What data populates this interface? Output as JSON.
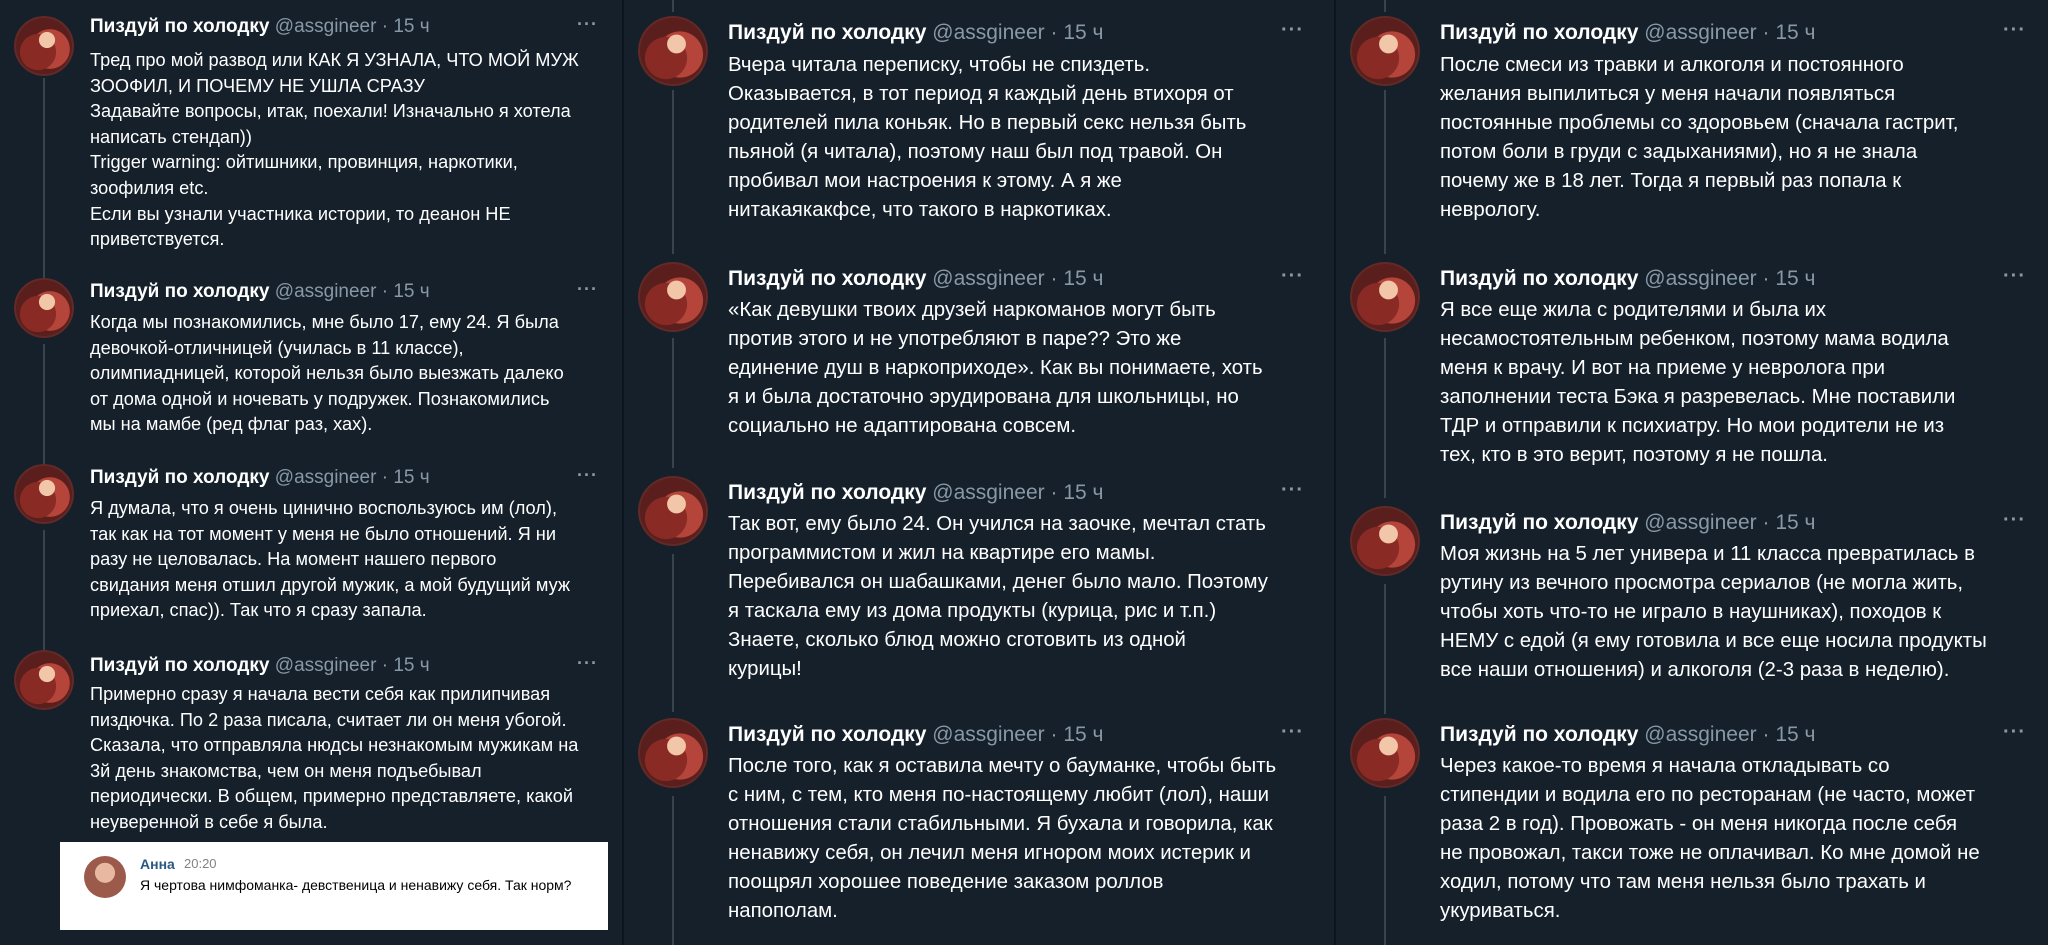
{
  "author": {
    "display_name": "Пиздуй по холодку",
    "handle": "@assgineer",
    "separator": "·",
    "time": "15 ч",
    "avatar_icon": "profile-photo"
  },
  "more_label": "···",
  "columns": [
    {
      "tweets": [
        {
          "text": "Тред про мой развод или КАК Я УЗНАЛА, ЧТО МОЙ МУЖ\nЗООФИЛ, И ПОЧЕМУ НЕ УШЛА СРАЗУ\nЗадавайте вопросы, итак, поехали! Изначально я хотела\nнаписать стендап))\nTrigger warning: ойтишники, провинция, наркотики,\nзоофилия etc.\nЕсли вы узнали участника истории, то деанон НЕ\nприветствуется."
        },
        {
          "text": "Когда мы познакомились, мне было 17, ему 24. Я была\nдевочкой-отличницей (училась в 11 классе),\nолимпиадницей, которой нельзя было выезжать далеко\nот дома одной и ночевать у подружек. Познакомились\nмы на мамбе (ред флаг раз, хах)."
        },
        {
          "text": "Я думала, что я очень цинично воспользуюсь им (лол),\nтак как на тот момент у меня не было отношений. Я ни\nразу не целовалась. На момент нашего первого\nсвидания меня отшил другой мужик, а мой будущий муж\nприехал, спас)). Так что я сразу запала."
        },
        {
          "text": "Примерно сразу я начала вести себя как прилипчивая\nпиздючка. По 2 раза писала, считает ли он меня убогой.\nСказала, что отправляла нюдсы незнакомым мужикам на\n3й день знакомства, чем он меня подъебывал\nпериодически. В общем, примерно представляете, какой\nнеуверенной в себе я была."
        }
      ],
      "quote_card": {
        "name": "Анна",
        "time": "20:20",
        "text": "Я чертова нимфоманка- девственица и ненавижу себя. Так норм?"
      }
    },
    {
      "tweets": [
        {
          "text": "Вчера читала переписку, чтобы не спиздеть.\nОказывается, в тот период я каждый день втихоря от\nродителей пила коньяк. Но в первый секс нельзя быть\nпьяной (я читала), поэтому наш был под травой. Он\nпробивал мои настроения к этому. А я же\nнитакаякакфсе, что такого в наркотиках."
        },
        {
          "text": "«Как девушки твоих друзей наркоманов могут быть\nпротив этого и не употребляют в паре?? Это же\nединение душ в наркоприходе».  Как вы понимаете, хоть\nя и была достаточно эрудирована для школьницы, но\nсоциально не адаптирована совсем."
        },
        {
          "text": "Так вот, ему было 24. Он учился на заочке, мечтал стать\nпрограммистом и жил на квартире его мамы.\nПеребивался он шабашками, денег было мало. Поэтому\nя таскала ему из дома продукты (курица, рис и т.п.)\nЗнаете, сколько блюд можно сготовить из одной\nкурицы!"
        },
        {
          "text": "После того, как я оставила мечту о бауманке, чтобы быть\nс ним, с тем, кто меня по-настоящему любит (лол), наши\nотношения стали стабильными. Я бухала и говорила, как\nненавижу себя, он лечил меня игнором моих истерик и\nпоощрял хорошее поведение заказом роллов\nнапополам."
        }
      ]
    },
    {
      "tweets": [
        {
          "text": "После смеси из травки и алкоголя и постоянного\nжелания выпилиться у меня начали появляться\nпостоянные проблемы со здоровьем (сначала гастрит,\nпотом боли в груди с задыханиями), но я не знала\nпочему же в 18 лет. Тогда я первый раз попала к\nневрологу."
        },
        {
          "text": "Я все еще жила с родителями и была их\nнесамостоятельным ребенком, поэтому мама водила\nменя к врачу. И вот на приеме у невролога при\nзаполнении теста Бэка я разревелась. Мне поставили\nТДР и отправили к психиатру. Но мои родители не из\nтех, кто в это верит, поэтому я не пошла."
        },
        {
          "text": "Моя жизнь на 5 лет универа и 11 класса превратилась в\nрутину из вечного просмотра сериалов (не могла жить,\nчтобы хоть что-то не играло в наушниках), походов к\nНЕМУ с едой (я ему готовила и все еще носила продукты\nвсе наши отношения) и алкоголя (2-3 раза в неделю)."
        },
        {
          "text": "Через какое-то время я начала откладывать со\nстипендии и водила его по ресторанам (не часто, может\nраза 2 в год). Провожать - он меня никогда после себя\nне провожал, такси тоже не оплачивал. Ко мне домой не\nходил, потому что там меня нельзя было трахать и\nукуриваться."
        }
      ]
    }
  ]
}
